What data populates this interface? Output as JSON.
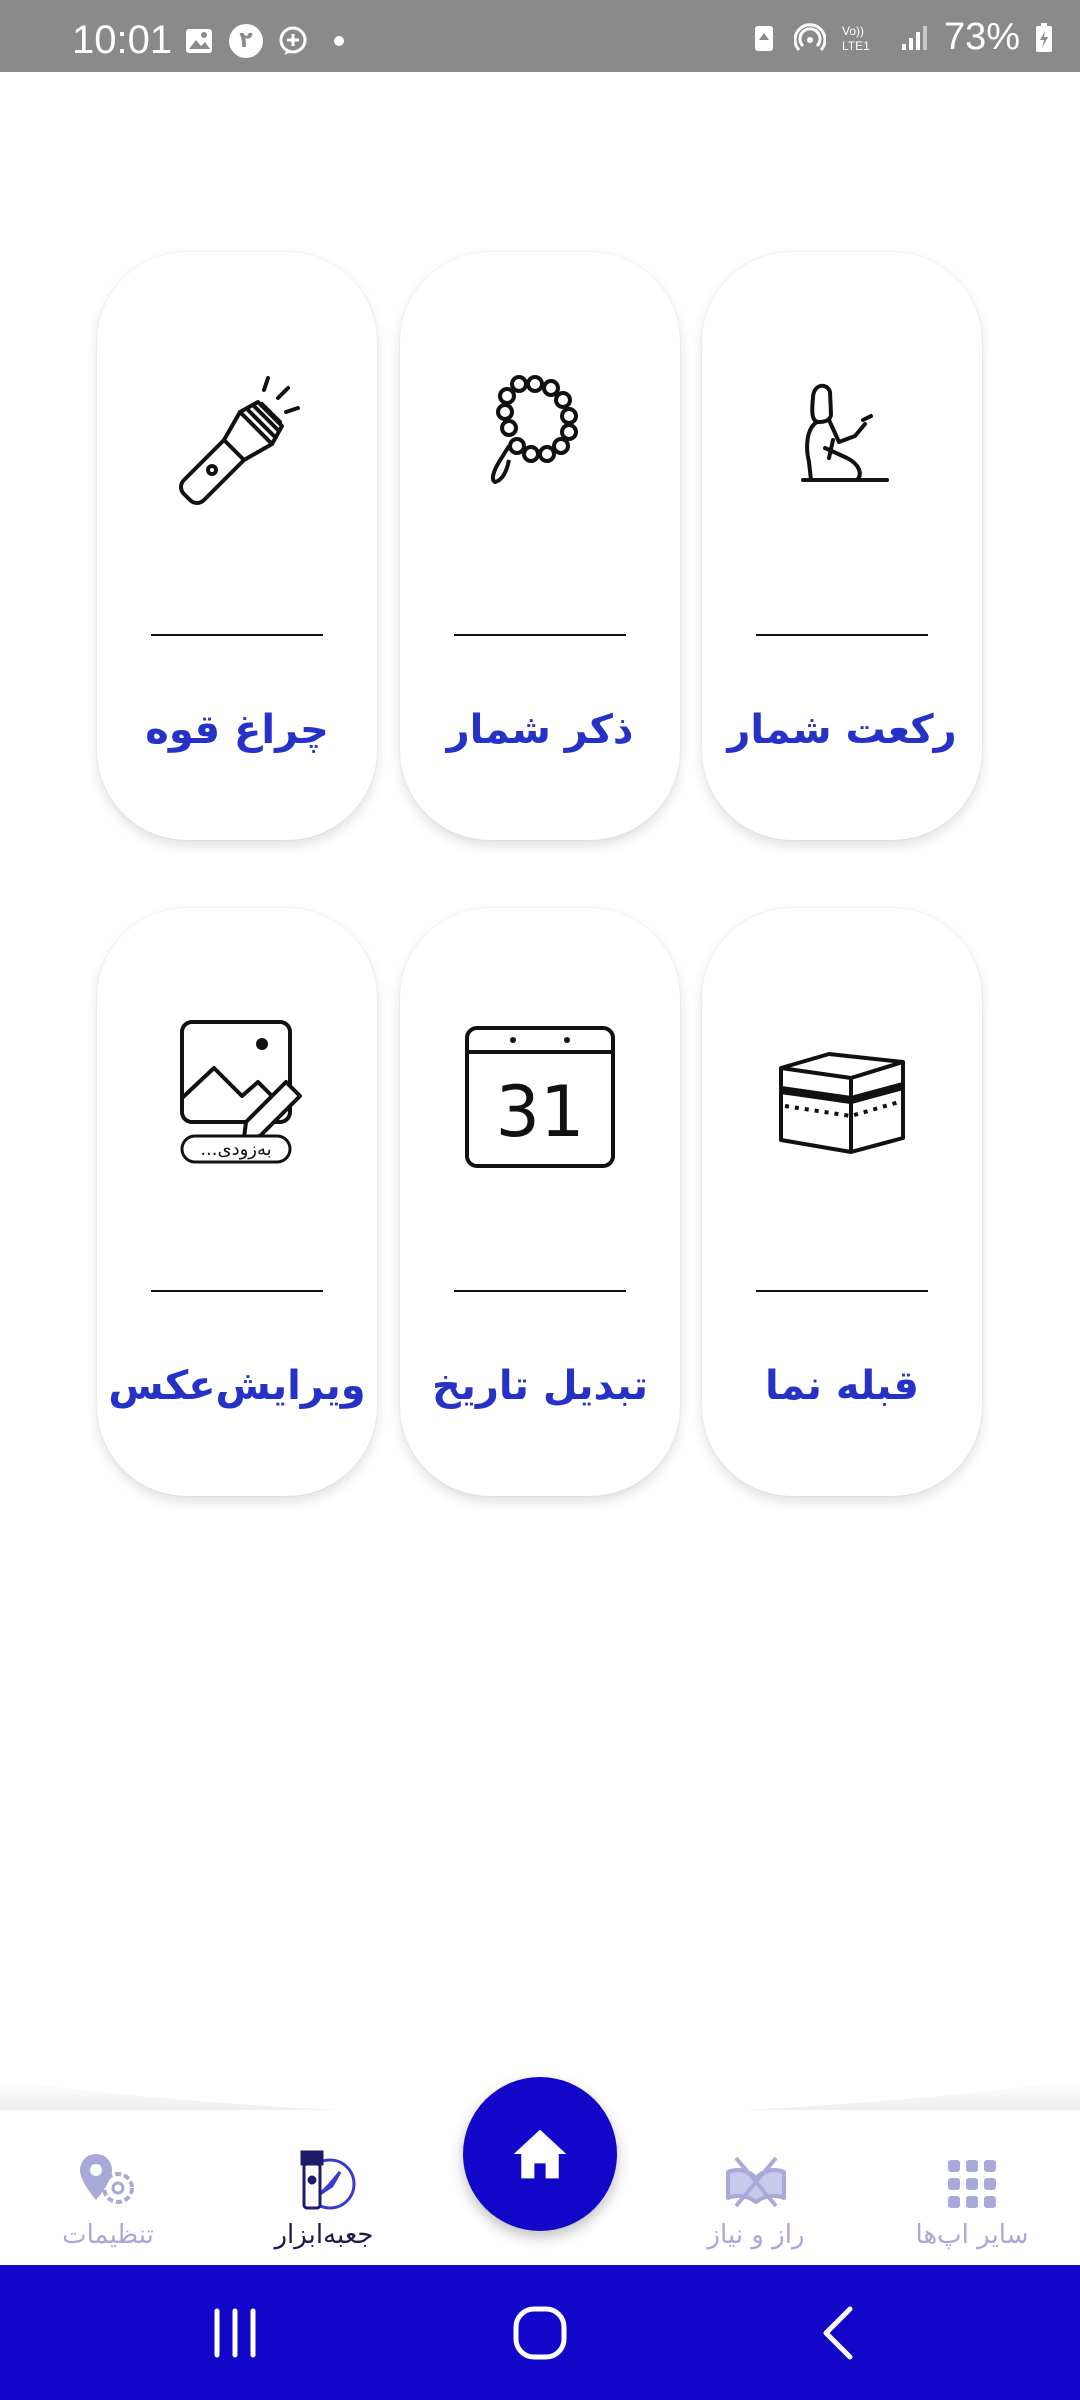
{
  "status_bar": {
    "time": "10:01",
    "battery": "73%",
    "notif_badge_digit": "۲"
  },
  "tools": [
    {
      "id": "rakat",
      "label": "رکعت شمار",
      "icon": "prayer-person-icon"
    },
    {
      "id": "zekr",
      "label": "ذکر شمار",
      "icon": "prayer-beads-icon"
    },
    {
      "id": "flashlight",
      "label": "چراغ قوه",
      "icon": "flashlight-icon"
    },
    {
      "id": "qibla",
      "label": "قبله نما",
      "icon": "kaaba-icon"
    },
    {
      "id": "date",
      "label": "تبدیل تاریخ",
      "icon": "calendar-icon",
      "calendar_number": "31"
    },
    {
      "id": "photo",
      "label": "ویرایش‌عکس",
      "icon": "photo-edit-icon",
      "soon_badge": "به‌زودی..."
    }
  ],
  "bottom_nav": {
    "items": [
      {
        "id": "other-apps",
        "label": "سایر اپ‌ها",
        "icon": "apps-grid-icon",
        "active": false
      },
      {
        "id": "raz-niaz",
        "label": "راز و نیاز",
        "icon": "quran-icon",
        "active": false
      },
      {
        "id": "home",
        "label": "",
        "icon": "home-icon",
        "active": false
      },
      {
        "id": "toolbox",
        "label": "جعبه‌ابزار",
        "icon": "toolbox-icon",
        "active": true
      },
      {
        "id": "settings",
        "label": "تنظیمات",
        "icon": "settings-location-icon",
        "active": false
      }
    ]
  },
  "colors": {
    "accent": "#1206c8",
    "label_blue": "#2631c7",
    "nav_inactive": "#a9a9d8",
    "status_bar": "#8a8a8a"
  }
}
